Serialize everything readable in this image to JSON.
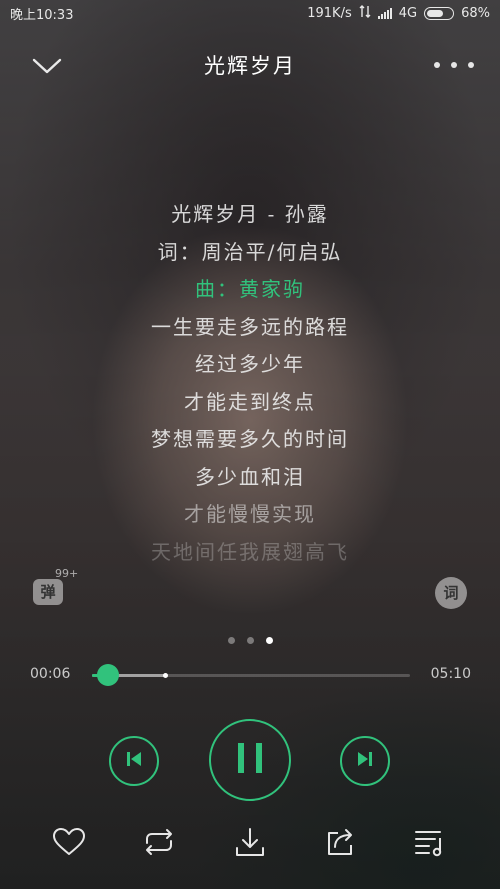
{
  "status_bar": {
    "time": "晚上10:33",
    "speed": "191K/s",
    "network": "4G",
    "battery": "68%",
    "battery_level": 0.68
  },
  "header": {
    "title": "光辉岁月"
  },
  "lyrics": [
    {
      "text": "光辉岁月 - 孙露",
      "state": "normal"
    },
    {
      "text": "词：周治平/何启弘",
      "state": "normal"
    },
    {
      "text": "曲：黄家驹",
      "state": "active"
    },
    {
      "text": "一生要走多远的路程",
      "state": "normal"
    },
    {
      "text": "经过多少年",
      "state": "normal"
    },
    {
      "text": "才能走到终点",
      "state": "normal"
    },
    {
      "text": "梦想需要多久的时间",
      "state": "normal"
    },
    {
      "text": "多少血和泪",
      "state": "normal"
    },
    {
      "text": "才能慢慢实现",
      "state": "dim"
    },
    {
      "text": "天地间任我展翅高飞",
      "state": "faded"
    }
  ],
  "danmaku": {
    "label": "弹",
    "count": "99+"
  },
  "lyric_toggle": {
    "label": "词"
  },
  "pager": {
    "count": 3,
    "active": 2
  },
  "progress": {
    "current": "00:06",
    "total": "05:10",
    "played_fraction": 0.05,
    "buffered_fraction": 0.23
  },
  "colors": {
    "accent": "#31c27c"
  },
  "icons": {
    "back": "chevron-down-icon",
    "more": "more-dots-icon",
    "prev": "skip-previous-icon",
    "play": "pause-icon",
    "next": "skip-next-icon",
    "like": "heart-icon",
    "repeat": "repeat-icon",
    "download": "download-icon",
    "share": "share-icon",
    "playlist": "playlist-icon"
  }
}
